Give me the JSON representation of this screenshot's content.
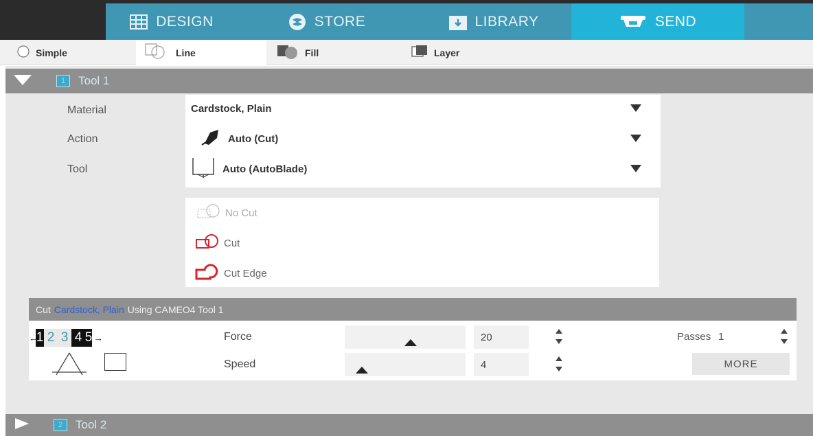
{
  "nav": {
    "tabs": [
      {
        "label": "DESIGN",
        "icon": "grid-icon"
      },
      {
        "label": "STORE",
        "icon": "store-icon"
      },
      {
        "label": "LIBRARY",
        "icon": "library-icon"
      },
      {
        "label": "SEND",
        "icon": "send-icon",
        "active": true
      }
    ]
  },
  "modes": [
    {
      "label": "Simple",
      "icon": "radio-icon"
    },
    {
      "label": "Line",
      "icon": "line-icon",
      "active": true
    },
    {
      "label": "Fill",
      "icon": "fill-icon"
    },
    {
      "label": "Layer",
      "icon": "layer-icon"
    }
  ],
  "tool1": {
    "number": "1",
    "title": "Tool 1",
    "labels": {
      "material": "Material",
      "action": "Action",
      "tool": "Tool"
    },
    "material": "Cardstock, Plain",
    "action": "Auto (Cut)",
    "tool": "Auto (AutoBlade)",
    "line_styles": [
      {
        "label": "No Cut",
        "icon": "no-cut-icon",
        "disabled": true
      },
      {
        "label": "Cut",
        "icon": "cut-icon"
      },
      {
        "label": "Cut Edge",
        "icon": "cut-edge-icon"
      }
    ]
  },
  "cut_settings": {
    "header_prefix": "Cut",
    "header_material": "Cardstock, Plain",
    "header_suffix": "Using CAMEO4 Tool 1",
    "blade_depth": {
      "digits": [
        "1",
        "2",
        "3",
        "4",
        "5"
      ],
      "selected": "4"
    },
    "force_label": "Force",
    "force_value": "20",
    "force_level": 0.55,
    "speed_label": "Speed",
    "speed_value": "4",
    "speed_level": 0.1,
    "passes_label": "Passes",
    "passes_value": "1",
    "more_label": "MORE"
  },
  "tool2": {
    "number": "2",
    "title": "Tool 2"
  },
  "colors": {
    "nav_bg": "#3f97b3",
    "nav_active": "#21b3d8",
    "header_gray": "#8f8f8f",
    "accent_red": "#d9232a",
    "link_blue": "#2f5fd0"
  }
}
